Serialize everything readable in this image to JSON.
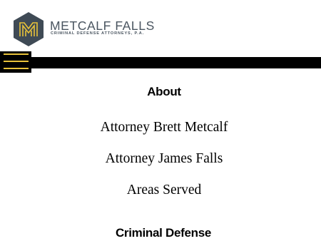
{
  "brand": {
    "name": "METCALF FALLS",
    "tagline": "CRIMINAL DEFENSE ATTORNEYS, P.A.",
    "colors": {
      "logo_hex": "#3f4a55",
      "logo_accent": "#e8c23a",
      "text": "#4a5560"
    }
  },
  "nav": {
    "menu_icon": "hamburger-menu-icon",
    "bar_color": "#000000",
    "accent_color": "#e8c23a"
  },
  "menu": {
    "about_heading": "About",
    "about_items": [
      {
        "label": "Attorney Brett Metcalf"
      },
      {
        "label": "Attorney James Falls"
      },
      {
        "label": "Areas Served"
      }
    ],
    "criminal_heading": "Criminal Defense"
  }
}
